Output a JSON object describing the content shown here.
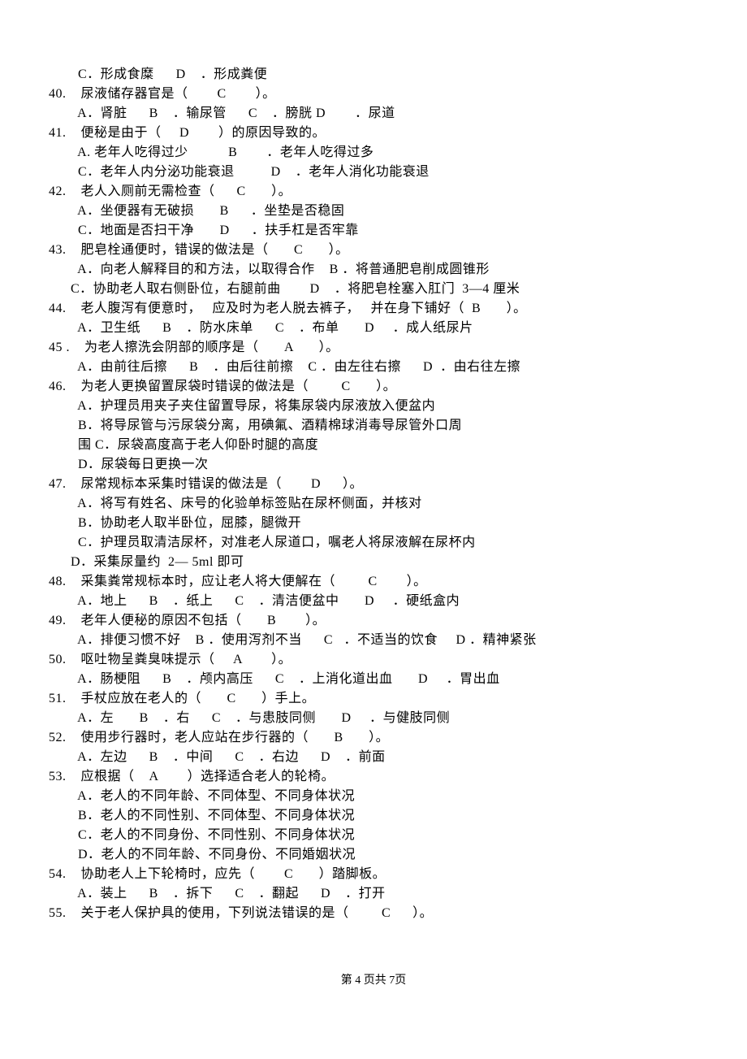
{
  "lines": [
    "        C．形成食糜      D    ．形成粪便",
    "40.    尿液储存器官是（        C        ）。",
    "        A．肾脏      B    ．输尿管      C    ．膀胱 D        ．尿道",
    "41.    便秘是由于（     D        ）的原因导致的。",
    "        A. 老年人吃得过少           B        ．老年人吃得过多",
    "        C．老年人内分泌功能衰退          D    ．老年人消化功能衰退",
    "42.    老人入厕前无需检查（      C       ）。",
    "        A．坐便器有无破损       B      ．坐垫是否稳固",
    "        C．地面是否扫干净       D      ．扶手杠是否牢靠",
    "43.    肥皂栓通便时，错误的做法是（       C       ）。",
    "        A．向老人解释目的和方法，以取得合作    B ．将普通肥皂削成圆锥形",
    "      C．协助老人取右侧卧位，右腿前曲        D    ．将肥皂栓塞入肛门  3—4 厘米",
    "44.    老人腹泻有便意时，   应及时为老人脱去裤子，   并在身下铺好（  B       ）。",
    "        A．卫生纸      B    ．防水床单      C    ．布单       D     ．成人纸尿片",
    "45 .    为老人擦洗会阴部的顺序是（       A       ）。",
    "        A．由前往后擦      B    ．由后往前擦    C ．由左往右擦      D  ．由右往左擦",
    "46.    为老人更换留置尿袋时错误的做法是（         C       ）。",
    "        A．护理员用夹子夹住留置导尿，将集尿袋内尿液放入便盆内",
    "        B．将导尿管与污尿袋分离，用碘氟、酒精棉球消毒导尿管外口周",
    "        围 C．尿袋高度高于老人仰卧时腿的高度",
    "        D．尿袋每日更换一次",
    "47.    尿常规标本采集时错误的做法是（        D      ）。",
    "        A．将写有姓名、床号的化验单标签贴在尿杯侧面，并核对",
    "        B．协助老人取半卧位，屈膝，腿微开",
    "        C．护理员取清洁尿杯，对准老人尿道口，嘱老人将尿液解在尿杯内",
    "      D．采集尿量约  2— 5ml 即可",
    "48.    采集粪常规标本时，应让老人将大便解在（         C        ）。",
    "        A．地上      B    ．纸上      C    ．清洁便盆中       D     ．硬纸盒内",
    "49.    老年人便秘的原因不包括（       B        ）。",
    "        A．排便习惯不好    B ．使用泻剂不当      C   ．不适当的饮食     D ．精神紧张",
    "50.    呕吐物呈粪臭味提示（     A        ）。",
    "        A．肠梗阻      B    ．颅内高压      C    ．上消化道出血       D     ．胃出血",
    "51.    手杖应放在老人的（       C       ）手上。",
    "        A．左       B    ．右      C    ．与患肢同侧       D     ．与健肢同侧",
    "52.    使用步行器时，老人应站在步行器的（       B       ）。",
    "        A．左边      B    ．中间      C    ．右边      D    ．前面",
    "53.    应根据（    A        ）选择适合老人的轮椅。",
    "        A．老人的不同年龄、不同体型、不同身体状况",
    "        B．老人的不同性别、不同体型、不同身体状况",
    "        C．老人的不同身份、不同性别、不同身体状况",
    "        D．老人的不同年龄、不同身份、不同婚姻状况",
    "54.    协助老人上下轮椅时，应先（        C       ）踏脚板。",
    "        A．装上      B    ．拆下      C    ．翻起      D    ．打开",
    "55.    关于老人保护具的使用，下列说法错误的是（         C      ）。"
  ],
  "footer": "第 4 页共 7页"
}
